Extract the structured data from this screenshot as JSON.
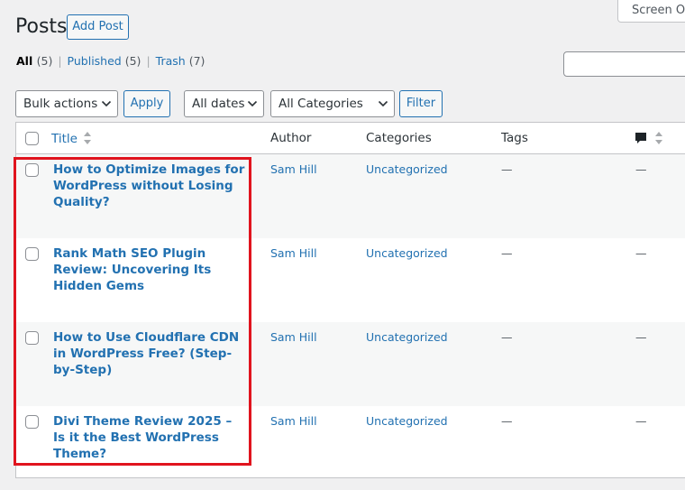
{
  "header": {
    "screen_options_label": "Screen Options",
    "title": "Posts",
    "add_post_label": "Add Post"
  },
  "views": [
    {
      "label": "All",
      "count": "(5)"
    },
    {
      "label": "Published",
      "count": "(5)"
    },
    {
      "label": "Trash",
      "count": "(7)"
    }
  ],
  "views_separator": "|",
  "toolbar": {
    "bulk_actions": "Bulk actions",
    "apply_label": "Apply",
    "dates": "All dates",
    "categories": "All Categories",
    "filter_label": "Filter"
  },
  "columns": {
    "title": "Title",
    "author": "Author",
    "categories": "Categories",
    "tags": "Tags"
  },
  "rows": [
    {
      "title": "How to Optimize Images for WordPress without Losing Quality?",
      "author": "Sam Hill",
      "category": "Uncategorized",
      "tags": "—",
      "comments": "—"
    },
    {
      "title": "Rank Math SEO Plugin Review: Uncovering Its Hidden Gems",
      "author": "Sam Hill",
      "category": "Uncategorized",
      "tags": "—",
      "comments": "—"
    },
    {
      "title": "How to Use Cloudflare CDN in WordPress Free? (Step-by-Step)",
      "author": "Sam Hill",
      "category": "Uncategorized",
      "tags": "—",
      "comments": "—"
    },
    {
      "title": "Divi Theme Review 2025 – Is it the Best WordPress Theme?",
      "author": "Sam Hill",
      "category": "Uncategorized",
      "tags": "—",
      "comments": "—"
    }
  ],
  "colors": {
    "link": "#2271b1",
    "highlight": "#e0141e",
    "background": "#f0f0f1"
  },
  "icons": {
    "select_caret": "chevron-down-icon",
    "sort": "sort-icon",
    "comments": "comment-bubble-icon"
  }
}
